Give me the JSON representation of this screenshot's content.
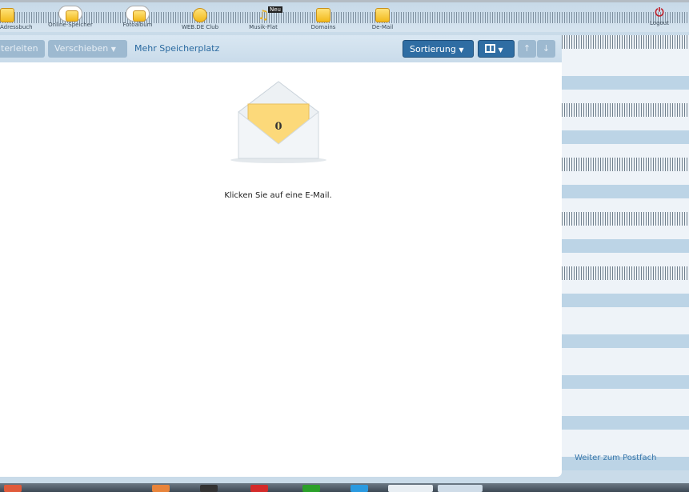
{
  "nav": {
    "items": [
      {
        "label": "Adressbuch",
        "visible_label": "ssbuch",
        "icon": "address-book-icon"
      },
      {
        "label": "Online-Speicher",
        "icon": "cloud-storage-icon"
      },
      {
        "label": "Fotoalbum",
        "icon": "photo-album-icon"
      },
      {
        "label": "WEB.DE Club",
        "icon": "club-icon"
      },
      {
        "label": "Musik-Flat",
        "icon": "music-icon",
        "badge": "Neu"
      },
      {
        "label": "Domains",
        "icon": "domains-icon"
      },
      {
        "label": "De-Mail",
        "icon": "de-mail-icon"
      }
    ],
    "logout": "Logout"
  },
  "toolbar": {
    "forward": "iterleiten",
    "move": "Verschieben",
    "more_storage": "Mehr Speicherplatz",
    "sort": "Sortierung"
  },
  "main": {
    "count": "0",
    "message": "Klicken Sie auf eine E-Mail."
  },
  "right": {
    "link": "Weiter zum Postfach"
  }
}
